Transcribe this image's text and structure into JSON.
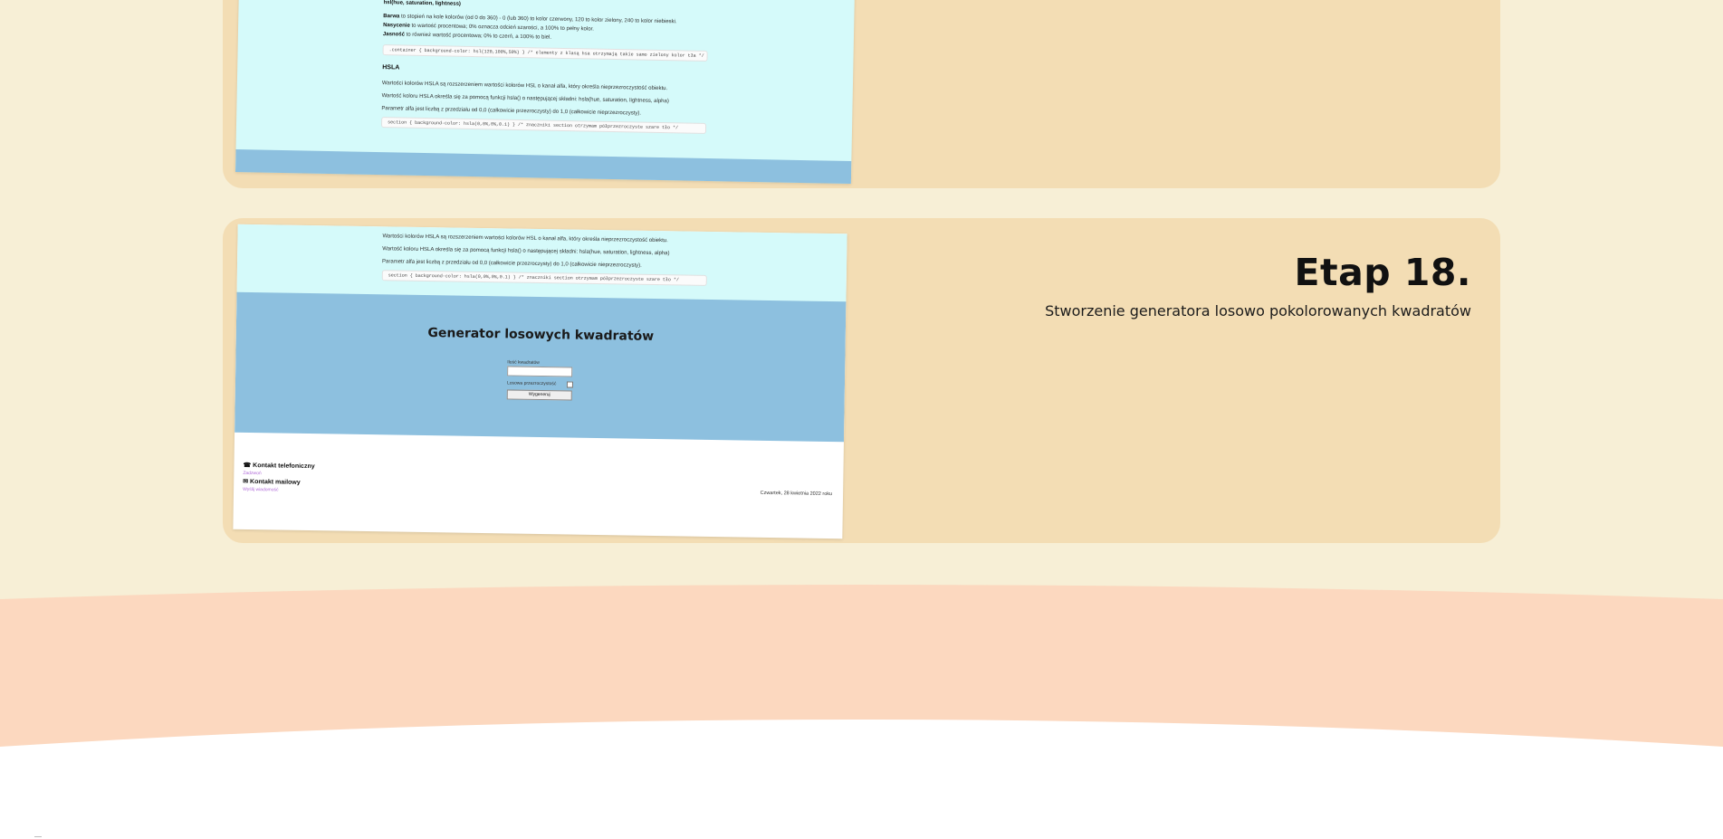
{
  "stage_prev": {
    "hsl_heading": "hsl(hue, saturation, lightness)",
    "hsl_lines": [
      {
        "bold": "Barwa",
        "text": " to stopień na kole kolorów (od 0 do 360) - 0 (lub 360) to kolor czerwony, 120 to kolor zielony, 240 to kolor niebieski."
      },
      {
        "bold": "Nasycenie",
        "text": " to wartość procentowa; 0% oznacza odcień szarości, a 100% to pełny kolor."
      },
      {
        "bold": "Jasność",
        "text": " to również wartość procentowa; 0% to czerń, a 100% to biel."
      }
    ],
    "hsl_code": ".container { background-color: hsl(120,100%,50%) } /* elementy z klasą hsa otrzymają takie samo zielony kolor tła */",
    "hsla_heading": "HSLA",
    "hsla_lines": [
      "Wartości kolorów HSLA są rozszerzeniem wartości kolorów HSL o kanał alfa, który określa nieprzezroczystość obiektu.",
      "Wartość koloru HSLA określa się za pomocą funkcji hsla() o następującej składni: hsla(hue, saturation, lightness, alpha)",
      "Parametr alfa jest liczbą z przedziału od 0,0 (całkowicie przezroczysty) do 1,0 (całkowicie nieprzezroczysty)."
    ],
    "hsla_code": "section { background-color: hsla(0,0%,0%,0.1) } /* znaczniki section otrzymam półprzezroczyste szare tło */"
  },
  "stage18": {
    "title": "Etap 18.",
    "description": "Stworzenie generatora losowo pokolorowanych kwadratów",
    "shot": {
      "top_lines": [
        "Wartości kolorów HSLA są rozszerzeniem wartości kolorów HSL o kanał alfa, który określa nieprzezroczystość obiektu.",
        "Wartość koloru HSLA określa się za pomocą funkcji hsla() o następującej składni: hsla(hue, saturation, lightness, alpha)",
        "Parametr alfa jest liczbą z przedziału od 0,0 (całkowicie przezroczysty) do 1,0 (całkowicie nieprzezroczysty)."
      ],
      "code": "section { background-color: hsla(0,0%,0%,0.1) } /* znaczniki section otrzymam półprzezroczyste szare tło */",
      "generator_title": "Generator losowych kwadratów",
      "count_label": "Ilość kwadratów",
      "random_opacity_label": "Losowa przezroczystość",
      "generate_button": "Wygeneruj",
      "contact_phone": "Kontakt telefoniczny",
      "call_link": "Zadzwoń",
      "contact_mail": "Kontakt mailowy",
      "mail_link": "Wyślij wiadomość",
      "date": "Czwartek, 28 kwietnia 2022 roku"
    }
  },
  "colors": {
    "page_bg": "#f7efd6",
    "card_bg": "#f3ddb4",
    "shot_cyan": "#d5fafa",
    "shot_blue": "#8dc0df",
    "footer_peach": "#fcd8bf",
    "link_purple": "#b06ad8"
  }
}
